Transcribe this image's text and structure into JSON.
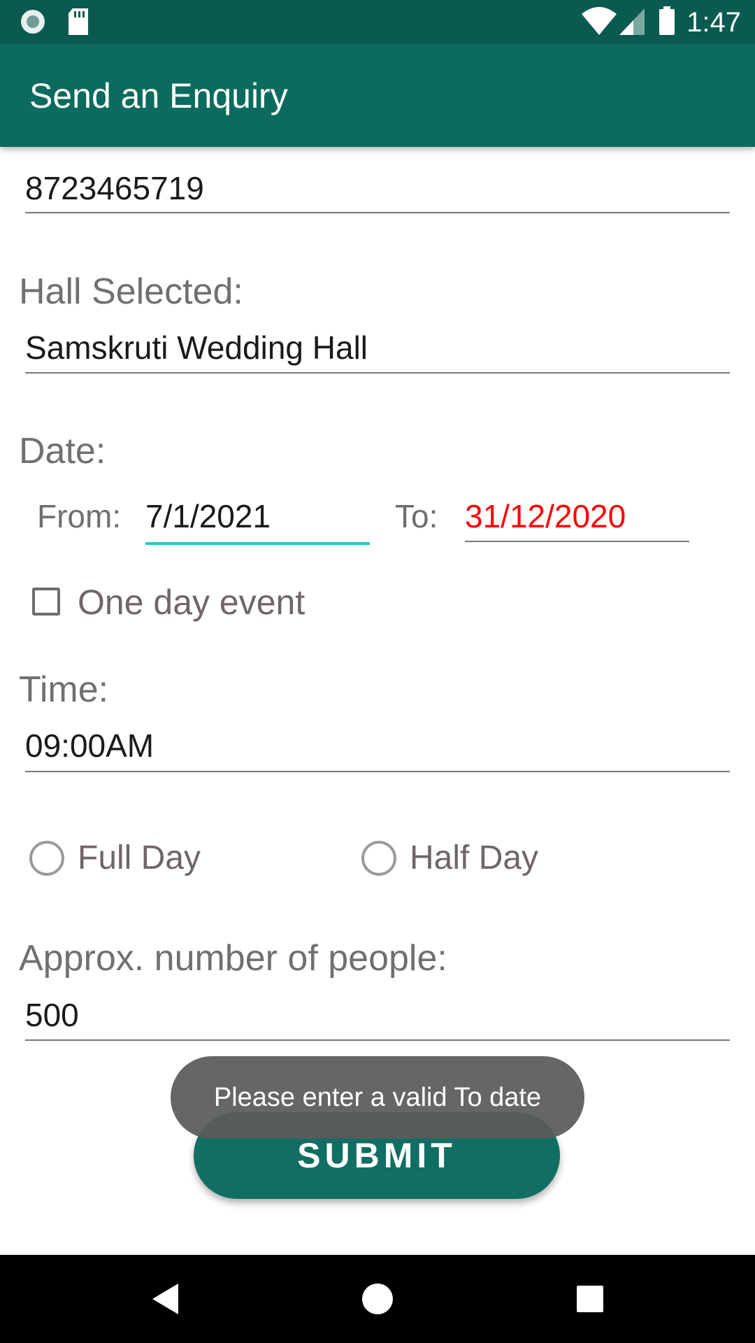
{
  "status_bar": {
    "time": "1:47",
    "left_icons": [
      "circle-notification-icon",
      "sd-card-icon"
    ],
    "right_icons": [
      "wifi-icon",
      "cell-signal-icon",
      "battery-icon"
    ]
  },
  "app_bar": {
    "title": "Send an Enquiry"
  },
  "form": {
    "phone": {
      "value": "8723465719"
    },
    "hall": {
      "label": "Hall Selected:",
      "value": "Samskruti Wedding Hall"
    },
    "date": {
      "label": "Date:",
      "from_label": "From:",
      "from_value": "7/1/2021",
      "to_label": "To:",
      "to_value": "31/12/2020"
    },
    "one_day_event": {
      "label": "One day event",
      "checked": false
    },
    "time": {
      "label": "Time:",
      "value": "09:00AM"
    },
    "duration": {
      "options": [
        {
          "label": "Full Day",
          "selected": false
        },
        {
          "label": "Half Day",
          "selected": false
        }
      ]
    },
    "people": {
      "label": "Approx. number of people:",
      "value": "500"
    }
  },
  "submit": {
    "label": "SUBMIT"
  },
  "toast": {
    "message": "Please enter a valid To date"
  },
  "colors": {
    "status_bar": "#0a5a50",
    "app_bar": "#0a6b5e",
    "button": "#116e62",
    "focus_underline": "#1ecdc0",
    "error_text": "#ff0000"
  },
  "nav_bar": {
    "buttons": [
      "back-icon",
      "home-icon",
      "recents-icon"
    ]
  }
}
